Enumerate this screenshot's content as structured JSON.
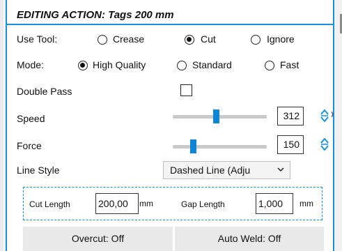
{
  "header": {
    "title": "EDITING ACTION: Tags 200 mm"
  },
  "tool": {
    "label": "Use Tool:",
    "options": [
      "Crease",
      "Cut",
      "Ignore"
    ],
    "selected": "Cut"
  },
  "mode": {
    "label": "Mode:",
    "options": [
      "High Quality",
      "Standard",
      "Fast"
    ],
    "selected": "High Quality"
  },
  "double_pass": {
    "label": "Double Pass",
    "checked": false
  },
  "speed": {
    "label": "Speed",
    "value": "312"
  },
  "force": {
    "label": "Force",
    "value": "150"
  },
  "line_style": {
    "label": "Line Style",
    "value": "Dashed Line (Adju"
  },
  "cut_length": {
    "label": "Cut Length",
    "value": "200,00",
    "unit": "mm"
  },
  "gap_length": {
    "label": "Gap Length",
    "value": "1,000",
    "unit": "mm"
  },
  "buttons": {
    "overcut": "Overcut: Off",
    "auto_weld": "Auto Weld: Off"
  },
  "colors": {
    "accent": "#1a8fe0",
    "slider_thumb": "#0e86d4"
  },
  "icons": {
    "spin": "spin-up-down-icon",
    "dropdown": "chevron-down-icon",
    "cursor": "mouse-cursor-icon"
  }
}
